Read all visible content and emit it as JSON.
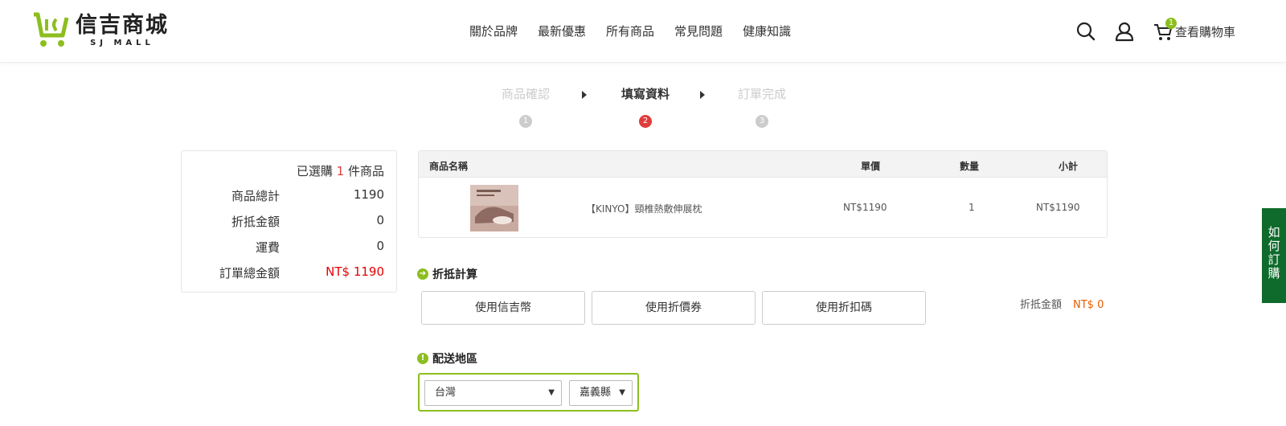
{
  "header": {
    "logo": {
      "name": "信吉商城",
      "sub": "SJ MALL"
    },
    "nav": [
      "關於品牌",
      "最新優惠",
      "所有商品",
      "常見問題",
      "健康知識"
    ],
    "cart": {
      "badge": "1",
      "label": "查看購物車"
    },
    "icons": {
      "search": "search-icon",
      "user": "user-icon",
      "cart": "cart-icon"
    }
  },
  "steps": [
    {
      "label": "商品確認",
      "num": "1"
    },
    {
      "label": "填寫資料",
      "num": "2"
    },
    {
      "label": "訂單完成",
      "num": "3"
    }
  ],
  "summary": {
    "head_pre": "已選購 ",
    "count": "1",
    "head_post": " 件商品",
    "rows": [
      {
        "label": "商品總計",
        "value": "1190"
      },
      {
        "label": "折抵金額",
        "value": "0"
      },
      {
        "label": "運費",
        "value": "0"
      },
      {
        "label": "訂單總金額",
        "value": "NT$ 1190"
      }
    ]
  },
  "table": {
    "headers": {
      "name": "商品名稱",
      "price": "單價",
      "qty": "數量",
      "subtotal": "小計"
    },
    "rows": [
      {
        "name": "【KINYO】頸椎熱敷伸展枕",
        "price": "NT$1190",
        "qty": "1",
        "subtotal": "NT$1190"
      }
    ]
  },
  "discount": {
    "title": "折抵計算",
    "buttons": [
      "使用信吉幣",
      "使用折價券",
      "使用折扣碼"
    ],
    "amount_label": "折抵金額",
    "amount_value": "NT$ 0"
  },
  "delivery": {
    "title": "配送地區",
    "country": "台灣",
    "county": "嘉義縣"
  },
  "side_tab": "如何訂購",
  "colors": {
    "accent": "#8cbe1f",
    "red": "#e60000",
    "side_tab": "#0e6b2b"
  }
}
